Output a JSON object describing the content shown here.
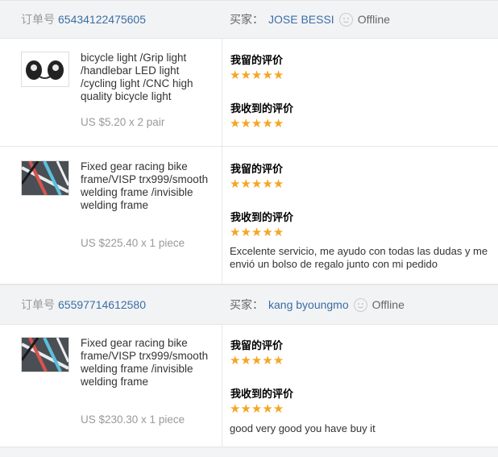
{
  "labels": {
    "order_label": "订单号",
    "buyer_label": "买家：",
    "my_feedback": "我留的评价",
    "received_feedback": "我收到的评价"
  },
  "orders": [
    {
      "order_number": "65434122475605",
      "buyer": "JOSE BESSI",
      "status": "Offline",
      "items": [
        {
          "title": "bicycle light /Grip light /handlebar LED light /cycling light /CNC high quality bicycle light",
          "price": "US $5.20 x 2 pair",
          "my_rating": 5,
          "received_rating": 5,
          "comment": ""
        },
        {
          "title": "Fixed gear racing bike frame/VISP trx999/smooth welding frame /invisible welding frame",
          "price": "US $225.40 x 1 piece",
          "my_rating": 5,
          "received_rating": 5,
          "comment": "Excelente servicio, me ayudo con todas las dudas y me envió un bolso de regalo junto con mi pedido"
        }
      ]
    },
    {
      "order_number": "65597714612580",
      "buyer": "kang byoungmo",
      "status": "Offline",
      "items": [
        {
          "title": "Fixed gear racing bike frame/VISP trx999/smooth welding frame /invisible welding frame",
          "price": "US $230.30 x 1 piece",
          "my_rating": 5,
          "received_rating": 5,
          "comment": "good very good you have buy it"
        }
      ]
    }
  ],
  "colors": {
    "link": "#3a6ea5",
    "star": "#f5a623",
    "header_bg": "#f2f3f5"
  }
}
